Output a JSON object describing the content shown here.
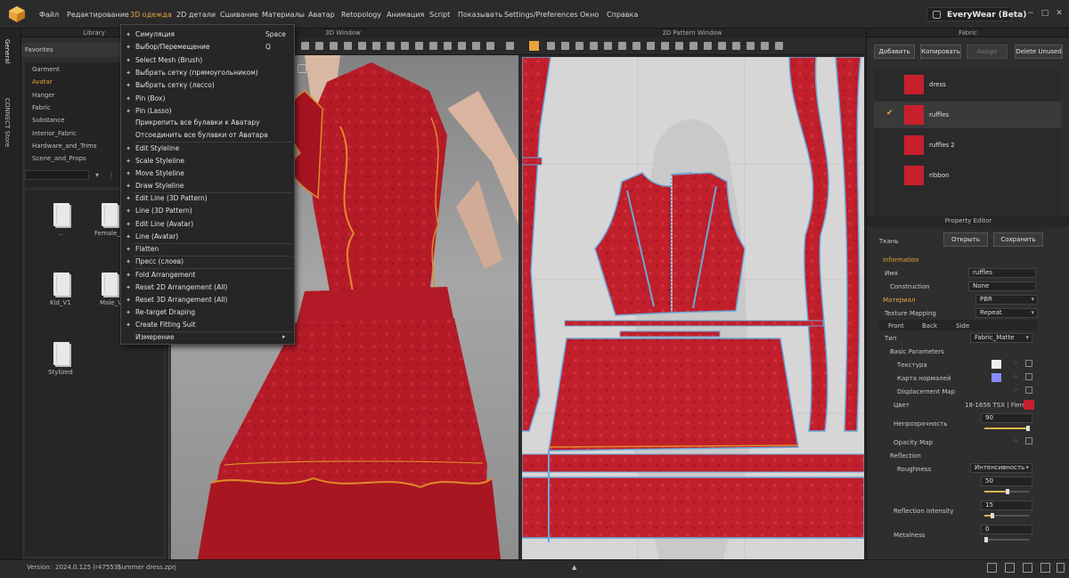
{
  "app": {
    "brand": "EveryWear (Beta)"
  },
  "menubar": {
    "items": [
      "Файл",
      "Редактирование",
      "3D одежда",
      "2D детали",
      "Сшивание",
      "Материалы",
      "Аватар",
      "Retopology",
      "Анимация",
      "Script",
      "Показывать",
      "Settings/Preferences",
      "Окно",
      "Справка"
    ],
    "active_index": 2
  },
  "sidebar_tabs": {
    "general": "General",
    "connect": "CONNECT Store"
  },
  "library": {
    "title": "Library",
    "favorites_label": "Favorites",
    "tree": [
      "Garment",
      "Avatar",
      "Hanger",
      "Fabric",
      "Substance",
      "Interior_Fabric",
      "Hardware_and_Trims",
      "Scene_and_Props"
    ],
    "selected_tree": "Avatar",
    "files": [
      "..",
      "Female_V",
      "Kid_V1",
      "Male_V",
      "Stylized"
    ]
  },
  "window3d": {
    "title": "3D Window"
  },
  "window2d": {
    "title": "2D Pattern Window"
  },
  "fabric_panel": {
    "title": "Fabric",
    "buttons": {
      "add": "Добавить",
      "copy": "Копировать",
      "assign": "Assign",
      "delete_unused": "Delete Unused"
    },
    "fabrics": [
      "dress",
      "ruffles",
      "ruffles 2",
      "ribbon"
    ],
    "selected_fabric": "ruffles",
    "swatch_color": "#c81f2c"
  },
  "property_editor": {
    "title": "Property Editor",
    "section_label": "Ткань",
    "open_btn": "Открыть",
    "save_btn": "Сохранить",
    "information": "Information",
    "name_label": "Имя",
    "name_value": "ruffles",
    "construction_label": "Construction",
    "construction_value": "None",
    "material_label": "Материал",
    "material_value": "PBR",
    "texture_mapping_label": "Texture Mapping",
    "texture_mapping_value": "Repeat",
    "sides": [
      "Front",
      "Back",
      "Side"
    ],
    "type_label": "Тип",
    "type_value": "Fabric_Matte",
    "basic_params": "Basic Parameters",
    "texture_label": "Текстура",
    "normal_map_label": "Карта нормалей",
    "displacement_label": "Displacement Map",
    "color_label": "Цвет",
    "color_value": "18-1656 TSX | Fierce",
    "color_hex": "#c81f2c",
    "opacity_label": "Непрозрачность",
    "opacity_value": "90",
    "opacity_map_label": "Opacity Map",
    "reflection_label": "Reflection",
    "roughness_label": "Roughness",
    "roughness_mode": "Интенсивность",
    "roughness_value": "50",
    "refl_intensity_label": "Reflection Intensity",
    "refl_intensity_value": "15",
    "metalness_label": "Metalness",
    "metalness_value": "0"
  },
  "status": {
    "version_label": "Version:",
    "version": "2024.0.125 (r47553)",
    "file": "Summer dress.zprj"
  },
  "menu": {
    "items": [
      {
        "label": "Симуляция",
        "shortcut": "Space",
        "icon": "sim-icon"
      },
      {
        "label": "Выбор/Перемещение",
        "shortcut": "Q",
        "icon": "select-icon"
      },
      {
        "label": "Select Mesh (Brush)",
        "shortcut": "",
        "icon": "brush-icon"
      },
      {
        "label": "Выбрать сетку (прямоугольником)",
        "shortcut": "",
        "icon": "rect-select-icon"
      },
      {
        "label": "Выбрать сетку (лассо)",
        "shortcut": "",
        "icon": "lasso-icon"
      },
      {
        "label": "Pin (Box)",
        "shortcut": "",
        "icon": "pin-box-icon"
      },
      {
        "label": "Pin (Lasso)",
        "shortcut": "",
        "icon": "pin-lasso-icon"
      },
      {
        "label": "Прикрепить все булавки к Аватару",
        "shortcut": "",
        "icon": ""
      },
      {
        "label": "Отсоединить все булавки от Аватара",
        "shortcut": "",
        "icon": ""
      },
      {
        "label": "Edit Styleline",
        "shortcut": "",
        "icon": "edit-styleline-icon"
      },
      {
        "label": "Scale Styleline",
        "shortcut": "",
        "icon": "scale-styleline-icon"
      },
      {
        "label": "Move Styleline",
        "shortcut": "",
        "icon": "move-styleline-icon"
      },
      {
        "label": "Draw Styleline",
        "shortcut": "",
        "icon": "draw-styleline-icon"
      },
      {
        "label": "Edit Line (3D Pattern)",
        "shortcut": "",
        "icon": "edit-line-icon"
      },
      {
        "label": "Line (3D Pattern)",
        "shortcut": "",
        "icon": "line-icon"
      },
      {
        "label": "Edit Line (Avatar)",
        "shortcut": "",
        "icon": "edit-line-avatar-icon"
      },
      {
        "label": "Line (Avatar)",
        "shortcut": "",
        "icon": "line-avatar-icon"
      },
      {
        "label": "Flatten",
        "shortcut": "",
        "icon": "flatten-icon"
      },
      {
        "label": "Пресс (слоев)",
        "shortcut": "",
        "icon": "press-icon"
      },
      {
        "label": "Fold Arrangement",
        "shortcut": "",
        "icon": "fold-icon"
      },
      {
        "label": "Reset 2D Arrangement (All)",
        "shortcut": "",
        "icon": "reset2d-icon"
      },
      {
        "label": "Reset 3D Arrangement (All)",
        "shortcut": "",
        "icon": "reset3d-icon"
      },
      {
        "label": "Re-target Draping",
        "shortcut": "",
        "icon": "retarget-icon"
      },
      {
        "label": "Create Fitting Suit",
        "shortcut": "",
        "icon": "fitting-suit-icon"
      },
      {
        "label": "Измерение",
        "shortcut": "",
        "icon": ""
      }
    ]
  },
  "colors": {
    "accent": "#e8a33c",
    "fabric_red": "#c81f2c",
    "stitch_blue": "#6aa7d8"
  }
}
